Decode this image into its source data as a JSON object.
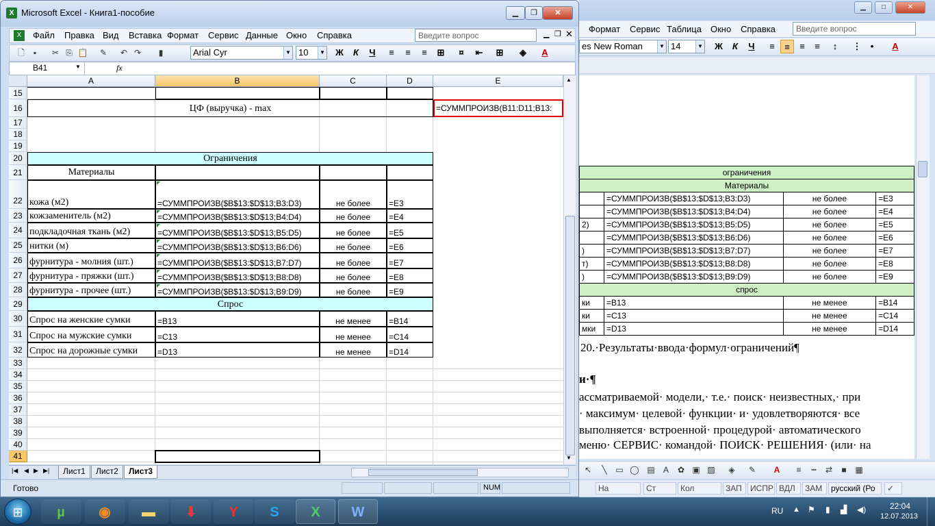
{
  "word": {
    "menu": [
      "Формат",
      "Сервис",
      "Таблица",
      "Окно",
      "Справка"
    ],
    "question_placeholder": "Введите вопрос",
    "font_name": "es New Roman",
    "font_size": "14",
    "fmt": {
      "bold": "Ж",
      "italic": "К",
      "underline": "Ч"
    },
    "table": {
      "header": "ограничения",
      "materials_header": "Материалы",
      "rows": [
        {
          "a": "",
          "b": "=СУММПРОИЗВ($B$13:$D$13;B3:D3)",
          "c": "не более",
          "d": "=E3"
        },
        {
          "a": "",
          "b": "=СУММПРОИЗВ($B$13:$D$13;B4:D4)",
          "c": "не более",
          "d": "=E4"
        },
        {
          "a": "2)",
          "b": "=СУММПРОИЗВ($B$13:$D$13;B5:D5)",
          "c": "не более",
          "d": "=E5"
        },
        {
          "a": "",
          "b": "=СУММПРОИЗВ($B$13:$D$13;B6:D6)",
          "c": "не более",
          "d": "=E6"
        },
        {
          "a": ")",
          "b": "=СУММПРОИЗВ($B$13:$D$13;B7:D7)",
          "c": "не более",
          "d": "=E7"
        },
        {
          "a": "т)",
          "b": "=СУММПРОИЗВ($B$13:$D$13;B8:D8)",
          "c": "не более",
          "d": "=E8"
        },
        {
          "a": ")",
          "b": "=СУММПРОИЗВ($B$13:$D$13;B9:D9)",
          "c": "не более",
          "d": "=E9"
        }
      ],
      "demand_header": "спрос",
      "demand_rows": [
        {
          "a": "ки",
          "b": "=B13",
          "c": "не менее",
          "d": "=B14"
        },
        {
          "a": "ки",
          "b": "=C13",
          "c": "не менее",
          "d": "=C14"
        },
        {
          "a": "мки",
          "b": "=D13",
          "c": "не менее",
          "d": "=D14"
        }
      ]
    },
    "caption": "20.·Результаты·ввода·формул·ограничений¶",
    "heading": "и·¶",
    "body_lines": [
      "ассматриваемой· модели,· т.е.· поиск· неизвестных,· при",
      "· максимум· целевой· функции· и· удовлетворяются· все",
      "выполняется· встроенной· процедурой· автоматического",
      "меню· СЕРВИС· командой· ПОИСК· РЕШЕНИЯ· (или· на"
    ],
    "status": {
      "na": "На",
      "st": "Ст",
      "kol": "Кол",
      "zap": "ЗАП",
      "ispr": "ИСПР",
      "vdl": "ВДЛ",
      "zam": "ЗАМ",
      "lang": "русский (Ро"
    }
  },
  "excel": {
    "title": "Microsoft Excel - Книга1-пособие",
    "menu": [
      "Файл",
      "Правка",
      "Вид",
      "Вставка",
      "Формат",
      "Сервис",
      "Данные",
      "Окно",
      "Справка"
    ],
    "question_placeholder": "Введите вопрос",
    "font_name": "Arial Cyr",
    "font_size": "10",
    "fmt": {
      "bold": "Ж",
      "italic": "К",
      "underline": "Ч"
    },
    "name_box": "B41",
    "fx": "fx",
    "columns": [
      "A",
      "B",
      "C",
      "D",
      "E"
    ],
    "rows": {
      "r15": "15",
      "r16": "16",
      "r17": "17",
      "r18": "18",
      "r19": "19",
      "r20": "20",
      "r21": "21",
      "r22": "22",
      "r23": "23",
      "r24": "24",
      "r25": "25",
      "r26": "26",
      "r27": "27",
      "r28": "28",
      "r29": "29",
      "r30": "30",
      "r31": "31",
      "r32": "32",
      "r33": "33",
      "r34": "34",
      "r35": "35",
      "r36": "36",
      "r37": "37",
      "r38": "38",
      "r39": "39",
      "r40": "40",
      "r41": "41"
    },
    "cells": {
      "objective": "ЦФ (выручка) - max",
      "objective_formula": "=СУММПРОИЗВ(B11:D11;B13:",
      "constraints_header": "Ограничения",
      "materials": "Материалы",
      "constraints": [
        {
          "a": "кожа (м2)",
          "b": "=СУММПРОИЗВ($B$13:$D$13;B3:D3)",
          "c": "не более",
          "d": "=E3"
        },
        {
          "a": "кожзаменитель (м2)",
          "b": "=СУММПРОИЗВ($B$13:$D$13;B4:D4)",
          "c": "не более",
          "d": "=E4"
        },
        {
          "a": "подкладочная ткань (м2)",
          "b": "=СУММПРОИЗВ($B$13:$D$13;B5:D5)",
          "c": "не более",
          "d": "=E5"
        },
        {
          "a": "нитки (м)",
          "b": "=СУММПРОИЗВ($B$13:$D$13;B6:D6)",
          "c": "не более",
          "d": "=E6"
        },
        {
          "a": "фурнитура - молния (шт.)",
          "b": "=СУММПРОИЗВ($B$13:$D$13;B7:D7)",
          "c": "не более",
          "d": "=E7"
        },
        {
          "a": "фурнитура - пряжки (шт.)",
          "b": "=СУММПРОИЗВ($B$13:$D$13;B8:D8)",
          "c": "не более",
          "d": "=E8"
        },
        {
          "a": "фурнитура - прочее (шт.)",
          "b": "=СУММПРОИЗВ($B$13:$D$13;B9:D9)",
          "c": "не более",
          "d": "=E9"
        }
      ],
      "demand_header": "Спрос",
      "demand": [
        {
          "a": "Спрос на женские сумки",
          "b": "=B13",
          "c": "не менее",
          "d": "=B14"
        },
        {
          "a": "Спрос на мужские сумки",
          "b": "=C13",
          "c": "не менее",
          "d": "=C14"
        },
        {
          "a": "Спрос на дорожные сумки",
          "b": "=D13",
          "c": "не менее",
          "d": "=D14"
        }
      ]
    },
    "sheets": [
      "Лист1",
      "Лист2",
      "Лист3"
    ],
    "status_ready": "Готово",
    "status_num": "NUM"
  },
  "tray": {
    "lang": "RU",
    "time": "22:04",
    "date": "12.07.2013"
  },
  "colors": {
    "cyan": "#ccffff",
    "green": "#cdf0c4",
    "select_red": "#e00000"
  }
}
